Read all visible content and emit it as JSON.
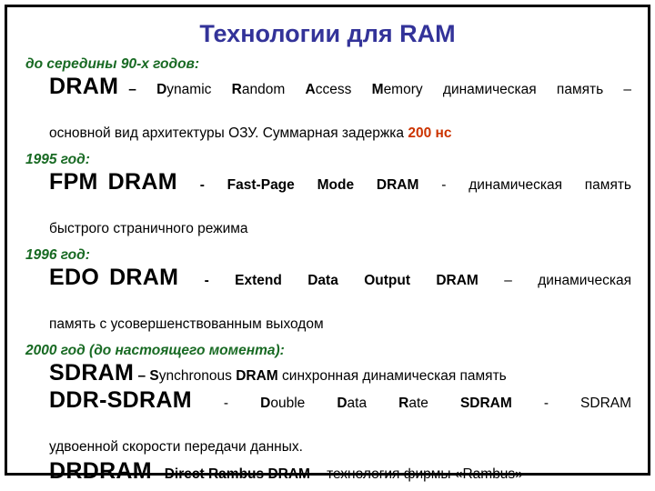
{
  "slide": {
    "title": "Технологии для RAM",
    "title_color": "#333399",
    "year_color": "#186A23",
    "accent_color": "#CC3300",
    "border_color": "#000000",
    "background_color": "#FFFFFF"
  },
  "sections": [
    {
      "year_label": "до середины 90-х годов:",
      "acronym": "DRAM",
      "dash": "–",
      "expansion": [
        {
          "initial": "D",
          "rest": "ynamic"
        },
        {
          "initial": "R",
          "rest": "andom"
        },
        {
          "initial": "A",
          "rest": "ccess"
        },
        {
          "initial": "M",
          "rest": "emory"
        }
      ],
      "description_line1": "динамическая память –",
      "description_line2_pre": "основной вид архитектуры ОЗУ. Суммарная задержка ",
      "description_line2_highlight": "200 нс"
    },
    {
      "year_label": "1995 год:",
      "acronym_part1": "FPM",
      "acronym_part2": "DRAM",
      "dash": "-",
      "expansion": [
        {
          "initial": "F",
          "rest": "ast-"
        },
        {
          "initial": "P",
          "rest": "age"
        },
        {
          "initial": "M",
          "rest": "ode"
        }
      ],
      "expansion_tail": "DRAM",
      "dash2": "-",
      "description_line1": "динамическая память",
      "description_line2": "быстрого страничного режима"
    },
    {
      "year_label": "1996 год:",
      "acronym_part1": "EDO",
      "acronym_part2": "DRAM",
      "dash": "-",
      "expansion": [
        {
          "initial": "E",
          "rest": "xtend"
        },
        {
          "initial": "D",
          "rest": "ata"
        },
        {
          "initial": "O",
          "rest": "utput"
        }
      ],
      "expansion_tail": "DRAM",
      "dash2": "–",
      "description_line1": "динамическая",
      "description_line2": "память с усовершенствованным выходом"
    },
    {
      "year_label": "2000 год (до настоящего момента):",
      "items": [
        {
          "acronym": "SDRAM",
          "dash": "–",
          "expansion": [
            {
              "initial": "S",
              "rest": "ynchronous"
            }
          ],
          "expansion_tail": "DRAM",
          "description": "синхронная динамическая память"
        },
        {
          "acronym": "DDR-SDRAM",
          "dash": "-",
          "expansion": [
            {
              "initial": "D",
              "rest": "ouble"
            },
            {
              "initial": "D",
              "rest": "ata"
            },
            {
              "initial": "R",
              "rest": "ate"
            }
          ],
          "expansion_tail": "SDRAM",
          "dash2": "-",
          "description_line1": "SDRAM",
          "description_line2": "удвоенной скорости передачи данных."
        },
        {
          "acronym": "DRDRAM",
          "dash": "-",
          "expansion": [
            {
              "initial": "D",
              "rest": "irect"
            },
            {
              "initial": "R",
              "rest": "ambus"
            }
          ],
          "expansion_tail": "DRAM",
          "dash2": "-",
          "description": "технология фирмы «Rambus»"
        }
      ]
    }
  ]
}
